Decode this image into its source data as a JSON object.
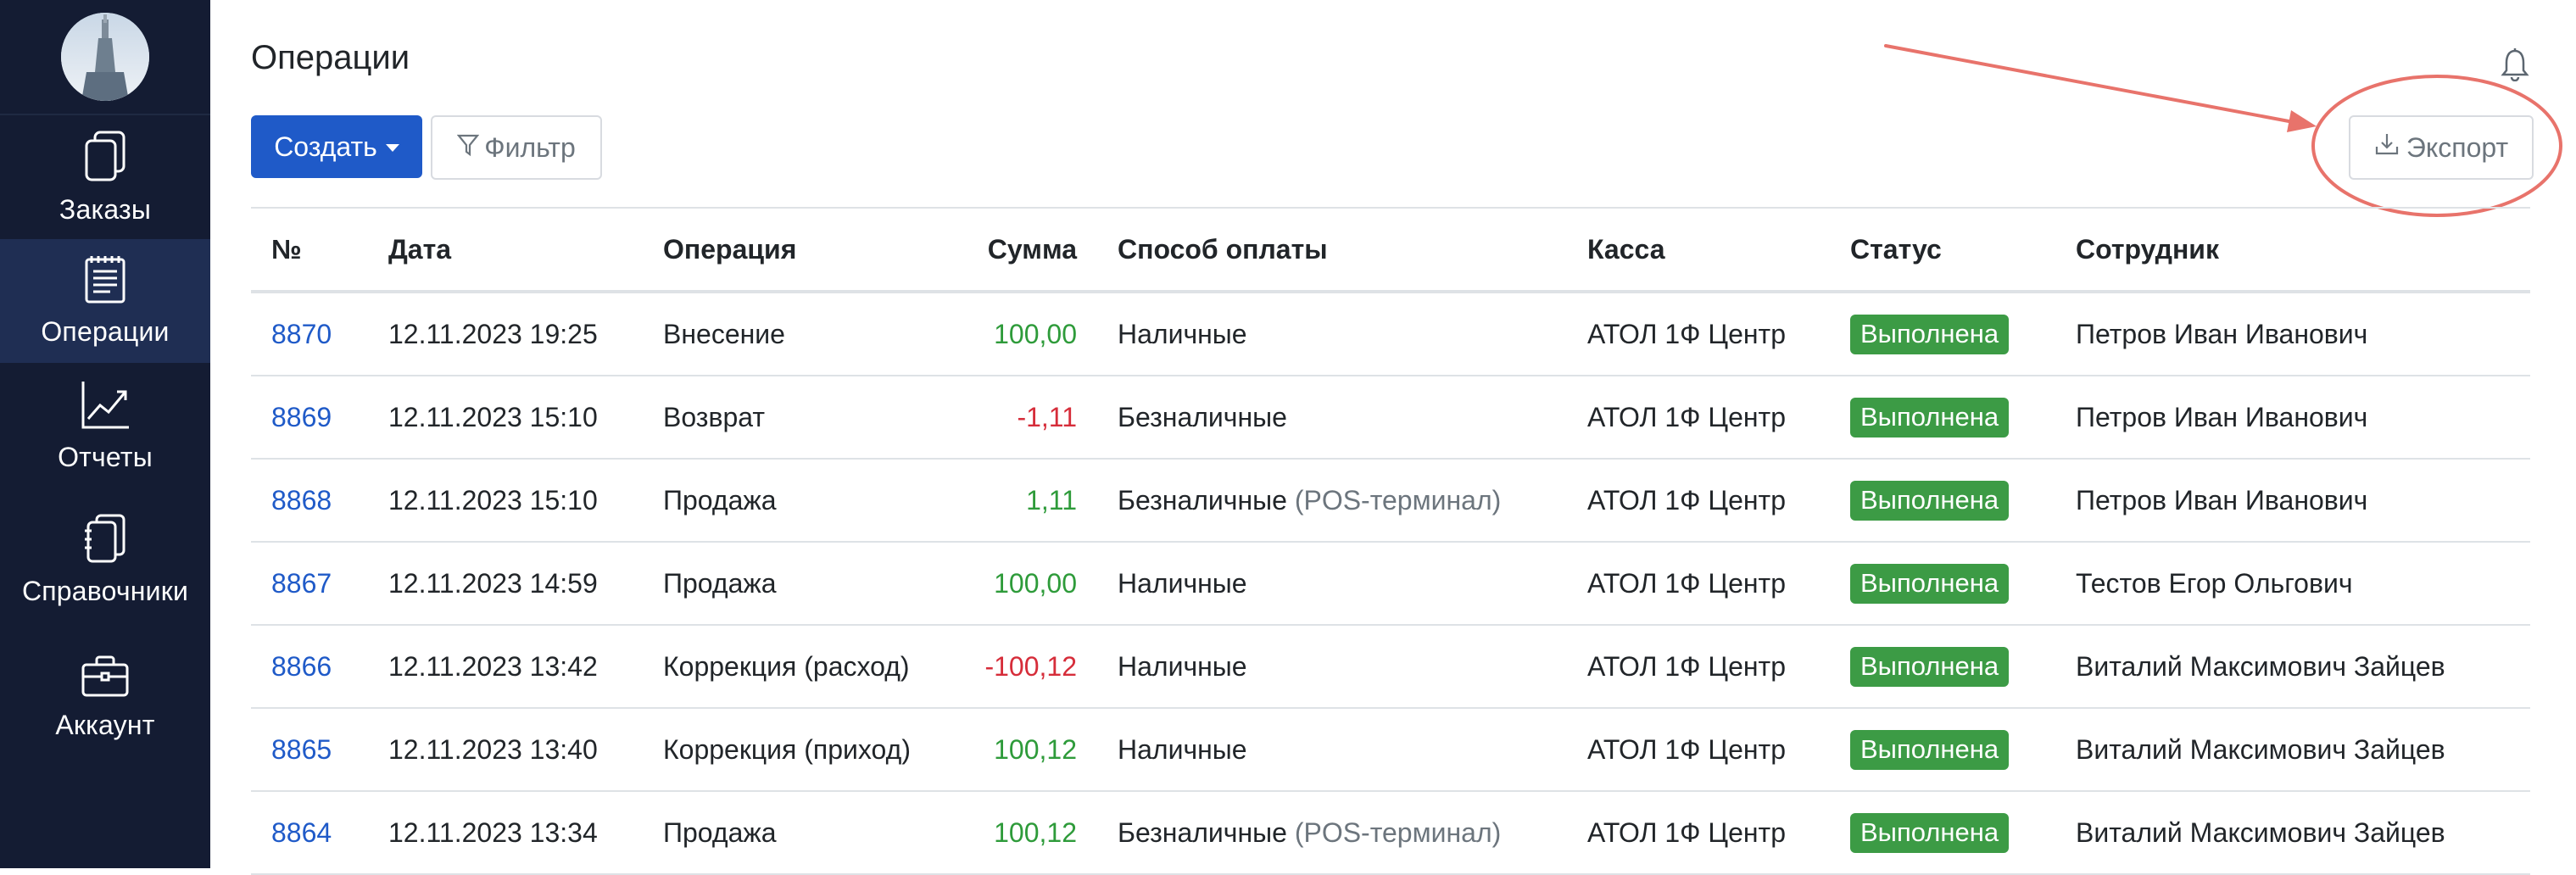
{
  "sidebar": {
    "items": [
      {
        "label": "Заказы",
        "icon": "orders-icon"
      },
      {
        "label": "Операции",
        "icon": "operations-icon",
        "active": true
      },
      {
        "label": "Отчеты",
        "icon": "chart-icon"
      },
      {
        "label": "Справочники",
        "icon": "books-icon"
      },
      {
        "label": "Аккаунт",
        "icon": "briefcase-icon"
      }
    ]
  },
  "header": {
    "title": "Операции"
  },
  "toolbar": {
    "create_label": "Создать",
    "filter_label": "Фильтр",
    "export_label": "Экспорт"
  },
  "table": {
    "columns": [
      "№",
      "Дата",
      "Операция",
      "Сумма",
      "Способ оплаты",
      "Касса",
      "Статус",
      "Сотрудник"
    ],
    "rows": [
      {
        "id": "8870",
        "date": "12.11.2023 19:25",
        "op": "Внесение",
        "amount": "100,00",
        "amount_sign": "pos",
        "payment": "Наличные",
        "payment_note": "",
        "register": "АТОЛ 1Ф Центр",
        "status": "Выполнена",
        "employee": "Петров Иван Иванович"
      },
      {
        "id": "8869",
        "date": "12.11.2023 15:10",
        "op": "Возврат",
        "amount": "-1,11",
        "amount_sign": "neg",
        "payment": "Безналичные",
        "payment_note": "",
        "register": "АТОЛ 1Ф Центр",
        "status": "Выполнена",
        "employee": "Петров Иван Иванович"
      },
      {
        "id": "8868",
        "date": "12.11.2023 15:10",
        "op": "Продажа",
        "amount": "1,11",
        "amount_sign": "pos",
        "payment": "Безналичные",
        "payment_note": "(POS-терминал)",
        "register": "АТОЛ 1Ф Центр",
        "status": "Выполнена",
        "employee": "Петров Иван Иванович"
      },
      {
        "id": "8867",
        "date": "12.11.2023 14:59",
        "op": "Продажа",
        "amount": "100,00",
        "amount_sign": "pos",
        "payment": "Наличные",
        "payment_note": "",
        "register": "АТОЛ 1Ф Центр",
        "status": "Выполнена",
        "employee": "Тестов Егор Ольгович"
      },
      {
        "id": "8866",
        "date": "12.11.2023 13:42",
        "op": "Коррекция (расход)",
        "amount": "-100,12",
        "amount_sign": "neg",
        "payment": "Наличные",
        "payment_note": "",
        "register": "АТОЛ 1Ф Центр",
        "status": "Выполнена",
        "employee": "Виталий Максимович Зайцев"
      },
      {
        "id": "8865",
        "date": "12.11.2023 13:40",
        "op": "Коррекция (приход)",
        "amount": "100,12",
        "amount_sign": "pos",
        "payment": "Наличные",
        "payment_note": "",
        "register": "АТОЛ 1Ф Центр",
        "status": "Выполнена",
        "employee": "Виталий Максимович Зайцев"
      },
      {
        "id": "8864",
        "date": "12.11.2023 13:34",
        "op": "Продажа",
        "amount": "100,12",
        "amount_sign": "pos",
        "payment": "Безналичные",
        "payment_note": "(POS-терминал)",
        "register": "АТОЛ 1Ф Центр",
        "status": "Выполнена",
        "employee": "Виталий Максимович Зайцев"
      }
    ]
  },
  "colors": {
    "sidebar_bg": "#141c33",
    "sidebar_active": "#1f2e53",
    "primary": "#1f5ac8",
    "positive": "#2e9b3a",
    "negative": "#d62d3a",
    "status_badge": "#3c9b45",
    "annotation": "#e8736b"
  }
}
